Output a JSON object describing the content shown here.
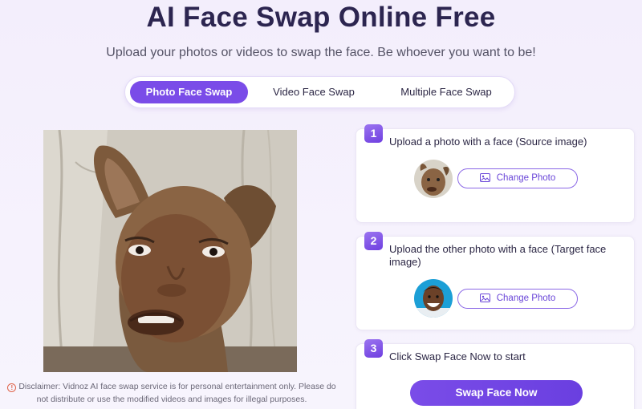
{
  "page": {
    "title": "AI Face Swap Online Free",
    "subtitle": "Upload your photos or videos to swap the face. Be whoever you want to be!"
  },
  "tabs": [
    {
      "label": "Photo Face Swap",
      "active": true
    },
    {
      "label": "Video Face Swap",
      "active": false
    },
    {
      "label": "Multiple Face Swap",
      "active": false
    }
  ],
  "disclaimer": "Disclaimer: Vidnoz AI face swap service is for personal entertainment only. Please do not distribute or use the modified videos and images for illegal purposes.",
  "steps": [
    {
      "number": "1",
      "text": "Upload a photo with a face (Source image)",
      "button": "Change Photo"
    },
    {
      "number": "2",
      "text": "Upload the other photo with a face (Target face image)",
      "button": "Change Photo"
    },
    {
      "number": "3",
      "text": "Click Swap Face Now to start",
      "button": "Swap Face Now"
    }
  ],
  "colors": {
    "accent": "#7a4ce8",
    "title": "#2c2550",
    "warning": "#e0644a"
  }
}
